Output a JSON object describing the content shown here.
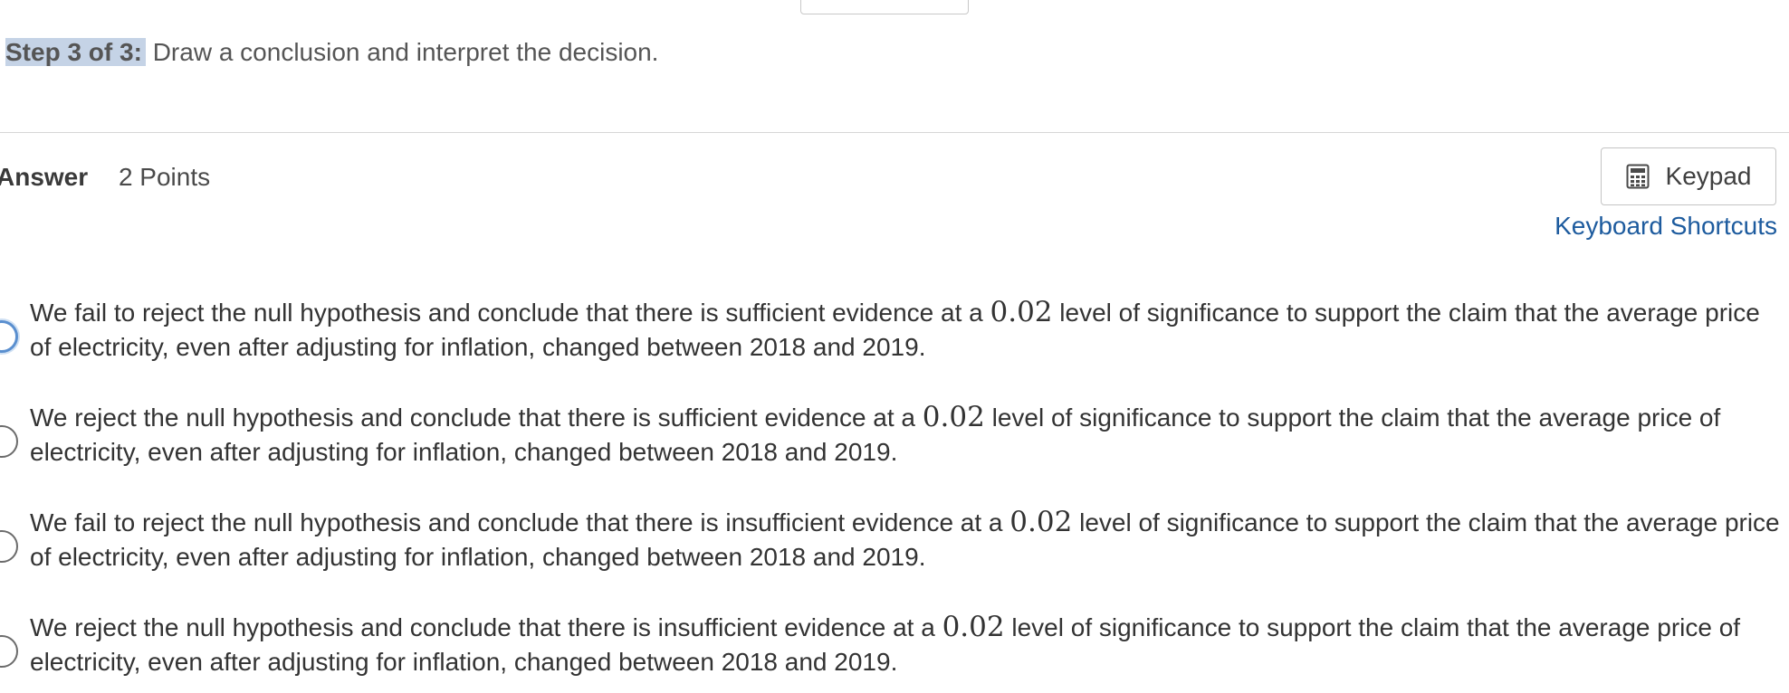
{
  "step": {
    "label": "Step 3 of 3:",
    "text": " Draw a conclusion and interpret the decision."
  },
  "answer": {
    "label": "Answer",
    "points": "2 Points"
  },
  "keypad": {
    "label": "Keypad",
    "icon": "calculator-icon"
  },
  "shortcuts": {
    "label": "Keyboard Shortcuts"
  },
  "significance": "0.02",
  "options": [
    {
      "before": "We fail to reject the null hypothesis and conclude that there is sufficient evidence at a ",
      "after": " level of significance to support the claim that the average price of electricity, even after adjusting for inflation, changed between 2018 and 2019."
    },
    {
      "before": "We reject the null hypothesis and conclude that there is sufficient evidence at a ",
      "after": " level of significance to support the claim that the average price of electricity, even after adjusting for inflation, changed between 2018 and 2019."
    },
    {
      "before": "We fail to reject the null hypothesis and conclude that there is insufficient evidence at a ",
      "after": " level of significance to support the claim that the average price of electricity, even after adjusting for inflation, changed between 2018 and 2019."
    },
    {
      "before": "We reject the null hypothesis and conclude that there is insufficient evidence at a ",
      "after": " level of significance to support the claim that the average price of electricity, even after adjusting for inflation, changed between 2018 and 2019."
    }
  ],
  "colors": {
    "link": "#1d5b9e",
    "step_highlight": "#c5d3e6",
    "radio_focus": "#5a8fcf"
  }
}
